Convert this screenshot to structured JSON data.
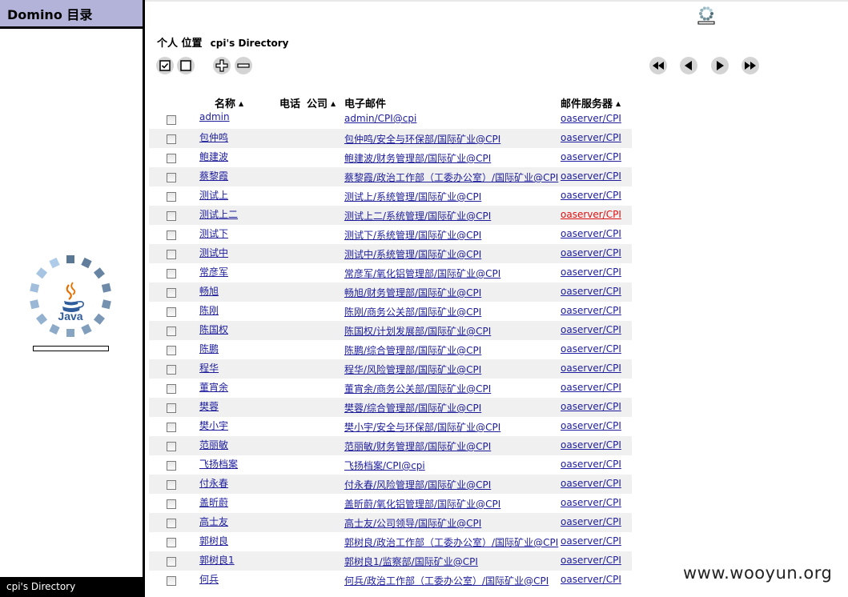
{
  "sidebar": {
    "title": "Domino 目录",
    "footer": "cpi's Directory"
  },
  "location": {
    "label": "个人 位置",
    "value": "cpi's Directory"
  },
  "table": {
    "headers": {
      "name": "名称",
      "phone": "电话",
      "company": "公司",
      "email": "电子邮件",
      "server": "邮件服务器"
    },
    "rows": [
      {
        "name": "admin",
        "email": "admin/CPI@cpi",
        "server": "oaserver/CPI"
      },
      {
        "name": "包仲鸣",
        "email": "包仲鸣/安全与环保部/国际矿业@CPI",
        "server": "oaserver/CPI"
      },
      {
        "name": "鲍建波",
        "email": "鲍建波/财务管理部/国际矿业@CPI",
        "server": "oaserver/CPI"
      },
      {
        "name": "蔡黎霞",
        "email": "蔡黎霞/政治工作部（工委办公室）/国际矿业@CPI",
        "server": "oaserver/CPI"
      },
      {
        "name": "测试上",
        "email": "测试上/系统管理/国际矿业@CPI",
        "server": "oaserver/CPI"
      },
      {
        "name": "测试上二",
        "email": "测试上二/系统管理/国际矿业@CPI",
        "server": "oaserver/CPI"
      },
      {
        "name": "测试下",
        "email": "测试下/系统管理/国际矿业@CPI",
        "server": "oaserver/CPI"
      },
      {
        "name": "测试中",
        "email": "测试中/系统管理/国际矿业@CPI",
        "server": "oaserver/CPI"
      },
      {
        "name": "常彦军",
        "email": "常彦军/氧化铝管理部/国际矿业@CPI",
        "server": "oaserver/CPI"
      },
      {
        "name": "畅旭",
        "email": "畅旭/财务管理部/国际矿业@CPI",
        "server": "oaserver/CPI"
      },
      {
        "name": "陈刚",
        "email": "陈刚/商务公关部/国际矿业@CPI",
        "server": "oaserver/CPI"
      },
      {
        "name": "陈国权",
        "email": "陈国权/计划发展部/国际矿业@CPI",
        "server": "oaserver/CPI"
      },
      {
        "name": "陈鹏",
        "email": "陈鹏/综合管理部/国际矿业@CPI",
        "server": "oaserver/CPI"
      },
      {
        "name": "程华",
        "email": "程华/风险管理部/国际矿业@CPI",
        "server": "oaserver/CPI"
      },
      {
        "name": "董宵余",
        "email": "董宵余/商务公关部/国际矿业@CPI",
        "server": "oaserver/CPI"
      },
      {
        "name": "樊蓉",
        "email": "樊蓉/综合管理部/国际矿业@CPI",
        "server": "oaserver/CPI"
      },
      {
        "name": "樊小宇",
        "email": "樊小宇/安全与环保部/国际矿业@CPI",
        "server": "oaserver/CPI"
      },
      {
        "name": "范丽敏",
        "email": "范丽敏/财务管理部/国际矿业@CPI",
        "server": "oaserver/CPI"
      },
      {
        "name": "飞扬档案",
        "email": "飞扬档案/CPI@cpi",
        "server": "oaserver/CPI"
      },
      {
        "name": "付永春",
        "email": "付永春/风险管理部/国际矿业@CPI",
        "server": "oaserver/CPI"
      },
      {
        "name": "盖昕蔚",
        "email": "盖昕蔚/氧化铝管理部/国际矿业@CPI",
        "server": "oaserver/CPI"
      },
      {
        "name": "高士友",
        "email": "高士友/公司领导/国际矿业@CPI",
        "server": "oaserver/CPI"
      },
      {
        "name": "郭树良",
        "email": "郭树良/政治工作部（工委办公室）/国际矿业@CPI",
        "server": "oaserver/CPI"
      },
      {
        "name": "郭树良1",
        "email": "郭树良1/监察部/国际矿业@CPI",
        "server": "oaserver/CPI"
      },
      {
        "name": "何兵",
        "email": "何兵/政治工作部（工委办公室）/国际矿业@CPI",
        "server": "oaserver/CPI"
      }
    ],
    "highlight_row": 5
  },
  "watermark": "www.wooyun.org",
  "colors": {
    "link": "#1d1d9c",
    "link_hot": "#e01010",
    "sidebar_title_bg": "#b3b3d9",
    "row_alt": "#f0f0f0"
  },
  "icons": {
    "select_all": "checked-box-icon",
    "deselect_all": "empty-box-icon",
    "expand": "plus-icon",
    "collapse": "minus-icon",
    "first": "rewind-icon",
    "prev": "prev-icon",
    "next": "next-icon",
    "last": "fast-forward-icon"
  }
}
